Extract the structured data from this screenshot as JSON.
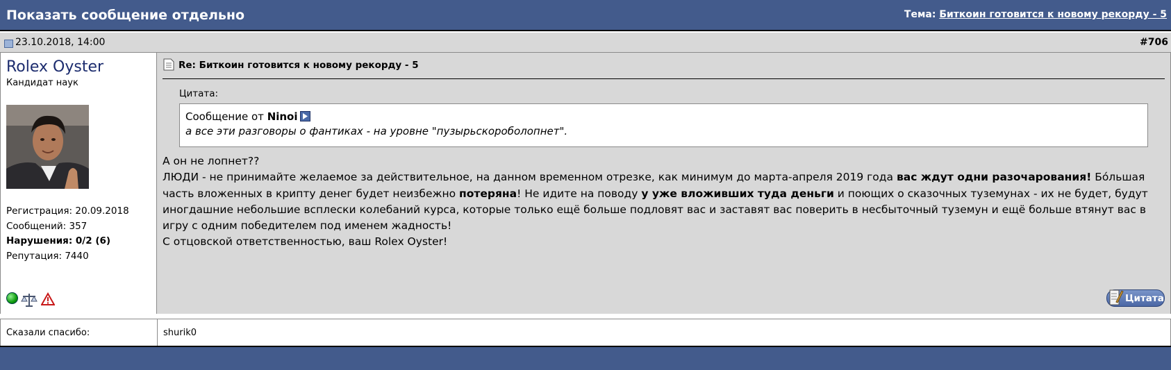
{
  "header": {
    "title": "Показать сообщение отдельно",
    "thread_prefix": "Тема:",
    "thread_title": "Биткоин готовится к новому рекорду - 5"
  },
  "post_meta": {
    "date": "23.10.2018, 14:00",
    "post_number": "#706"
  },
  "user": {
    "name": "Rolex Oyster",
    "title": "Кандидат наук",
    "registration": "Регистрация: 20.09.2018",
    "messages": "Сообщений: 357",
    "violations": "Нарушения: 0/2 (6)",
    "reputation": "Репутация: 7440",
    "icons": [
      "online-status-icon",
      "scales-icon",
      "warning-icon"
    ]
  },
  "post": {
    "title": "Re: Биткоин готовится к новому рекорду - 5",
    "quote_label": "Цитата:",
    "quote_from_prefix": "Сообщение от",
    "quote_author": "Ninoi",
    "quote_text": "а все эти разговоры о фантиках - на уровне \"пузырьскороболопнет\".",
    "line1": "А он не лопнет??",
    "line2_part1": "ЛЮДИ - не принимайте желаемое за действительное, на данном временном отрезке, как минимум до марта-апреля 2019 года ",
    "line2_bold1": "вас ждут одни разочарования!",
    "line2_part2": " Бо́льшая часть вложенных в крипту денег будет неизбежно ",
    "line2_bold2": "потеряна",
    "line2_part3": "! Не идите на поводу ",
    "line2_bold3": "у уже вложивших туда деньги",
    "line2_part4": " и поющих о сказочных туземунах - их не будет, будут иногдашние небольшие всплески колебаний курса, которые только ещё больше подловят вас и заставят вас поверить в несбыточный туземун и ещё больше втянут вас в игру с одним победителем под именем жадность!",
    "line3": "С отцовской ответственностью, ваш Rolex Oyster!",
    "quote_button": "Цитата"
  },
  "thanks": {
    "label": "Сказали спасибо:",
    "users": "shurik0"
  },
  "colors": {
    "header_bg": "#435b8c",
    "meta_bg": "#d8d8d8",
    "username": "#1c2c6e"
  }
}
